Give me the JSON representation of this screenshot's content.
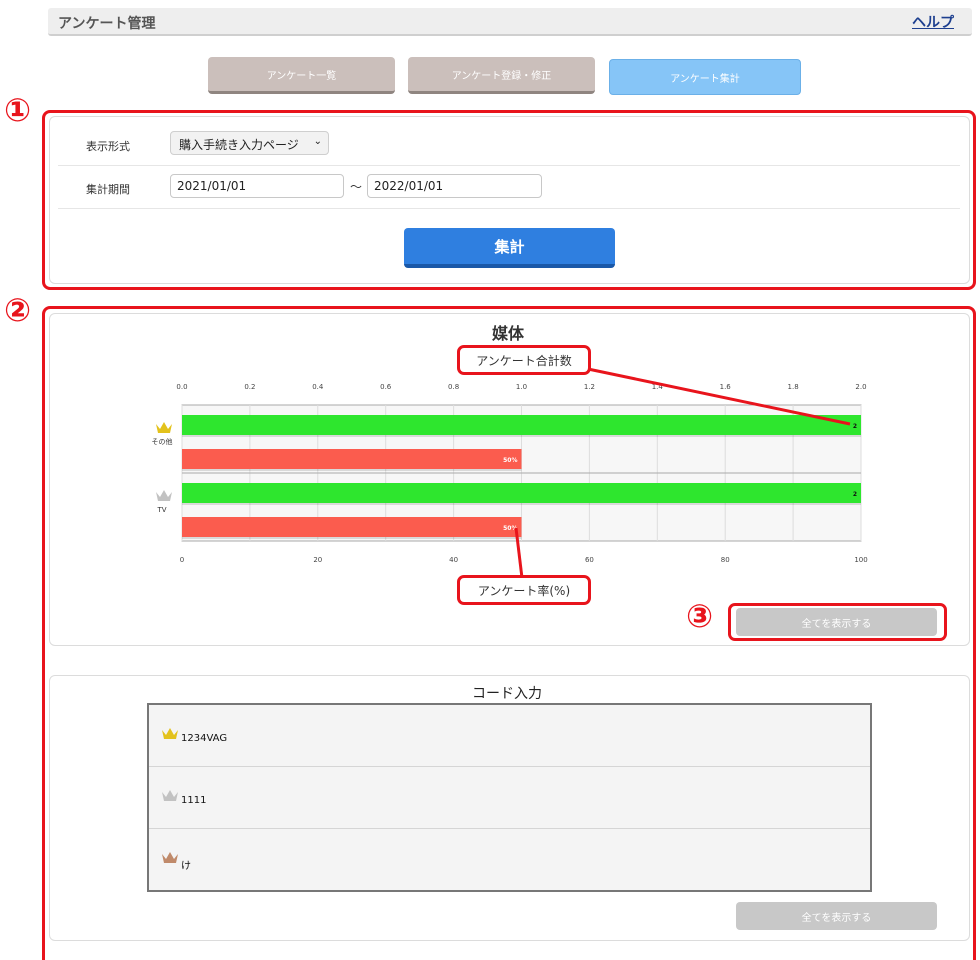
{
  "header": {
    "title": "アンケート管理",
    "help_label": "ヘルプ"
  },
  "tabs": [
    {
      "label": "アンケート一覧",
      "active": false
    },
    {
      "label": "アンケート登録・修正",
      "active": false
    },
    {
      "label": "アンケート集計",
      "active": true
    }
  ],
  "markers": {
    "one": "①",
    "two": "②",
    "three": "③"
  },
  "form": {
    "display_label": "表示形式",
    "display_value": "購入手続き入力ページ",
    "period_label": "集計期間",
    "date_from": "2021/01/01",
    "date_separator": "～",
    "date_to": "2022/01/01",
    "submit_label": "集計"
  },
  "media_section": {
    "title": "媒体",
    "callout_total": "アンケート合計数",
    "callout_rate": "アンケート率(%)",
    "show_all_label": "全てを表示する"
  },
  "chart_data": {
    "type": "bar",
    "orientation": "horizontal",
    "categories": [
      "その他",
      "TV"
    ],
    "category_icons": [
      "gold-crown",
      "silver-crown"
    ],
    "top_axis_ticks": [
      "0.0",
      "0.2",
      "0.4",
      "0.6",
      "0.8",
      "1.0",
      "1.2",
      "1.4",
      "1.6",
      "1.8",
      "2.0"
    ],
    "bottom_axis_ticks": [
      "0",
      "20",
      "40",
      "60",
      "80",
      "100"
    ],
    "top_axis_range": [
      0,
      2
    ],
    "bottom_axis_range": [
      0,
      100
    ],
    "series": [
      {
        "values": [
          2,
          2
        ],
        "labels": [
          "2",
          "2"
        ],
        "color": "#2ee62e",
        "axis": "top"
      },
      {
        "values": [
          50,
          50
        ],
        "labels": [
          "50%",
          "50%"
        ],
        "color": "#fb5c4e",
        "axis": "bottom"
      }
    ],
    "grid": true
  },
  "code_section": {
    "title": "コード入力",
    "rows": [
      {
        "crown": "gold",
        "text": "1234VAG"
      },
      {
        "crown": "silver",
        "text": "1111"
      },
      {
        "crown": "bronze",
        "text": "け"
      }
    ],
    "show_all_label": "全てを表示する"
  },
  "colors": {
    "accent_red": "#e8141c",
    "primary_blue": "#2f7fe0",
    "active_tab": "#86c5f7"
  }
}
